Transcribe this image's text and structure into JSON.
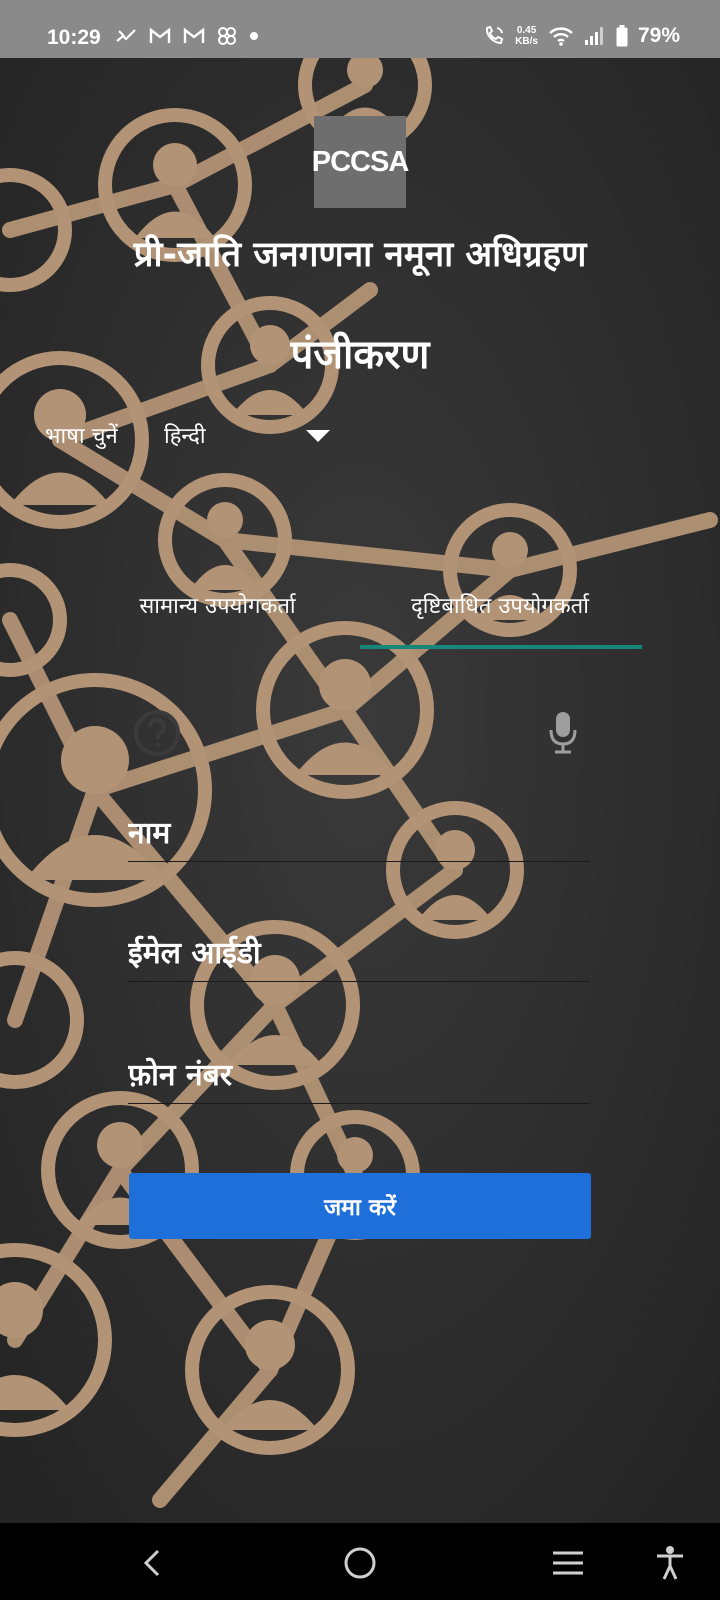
{
  "status_bar": {
    "time": "10:29",
    "net_speed_value": "0.45",
    "net_speed_unit": "KB/s",
    "battery": "79%",
    "left_icons": [
      "missed-call-icon",
      "gmail-icon",
      "gmail-icon",
      "pinwheel-icon",
      "dot-icon"
    ],
    "right_icons": [
      "wifi-call-icon",
      "wifi-icon",
      "signal-icon",
      "battery-icon"
    ]
  },
  "logo_text": "PCCSA",
  "app_title": "प्री-जाति जनगणना नमूना अधिग्रहण",
  "page_heading": "पंजीकरण",
  "language": {
    "label": "भाषा चुनें",
    "selected": "हिन्दी"
  },
  "tabs": [
    {
      "label": "सामान्य उपयोगकर्ता",
      "active": false
    },
    {
      "label": "दृष्टिबाधित उपयोगकर्ता",
      "active": true
    }
  ],
  "form": {
    "name_placeholder": "नाम",
    "email_placeholder": "ईमेल आईडी",
    "phone_placeholder": "फ़ोन नंबर",
    "submit_label": "जमा करें"
  },
  "colors": {
    "accent_blue": "#1e6fd9",
    "tab_indicator": "#16857a",
    "background": "#2b2b2b",
    "wood": "#b39375",
    "status_bar": "#8a8a8a"
  },
  "nav_bar": {
    "icons": [
      "back-icon",
      "home-icon",
      "recents-icon",
      "accessibility-icon"
    ]
  }
}
